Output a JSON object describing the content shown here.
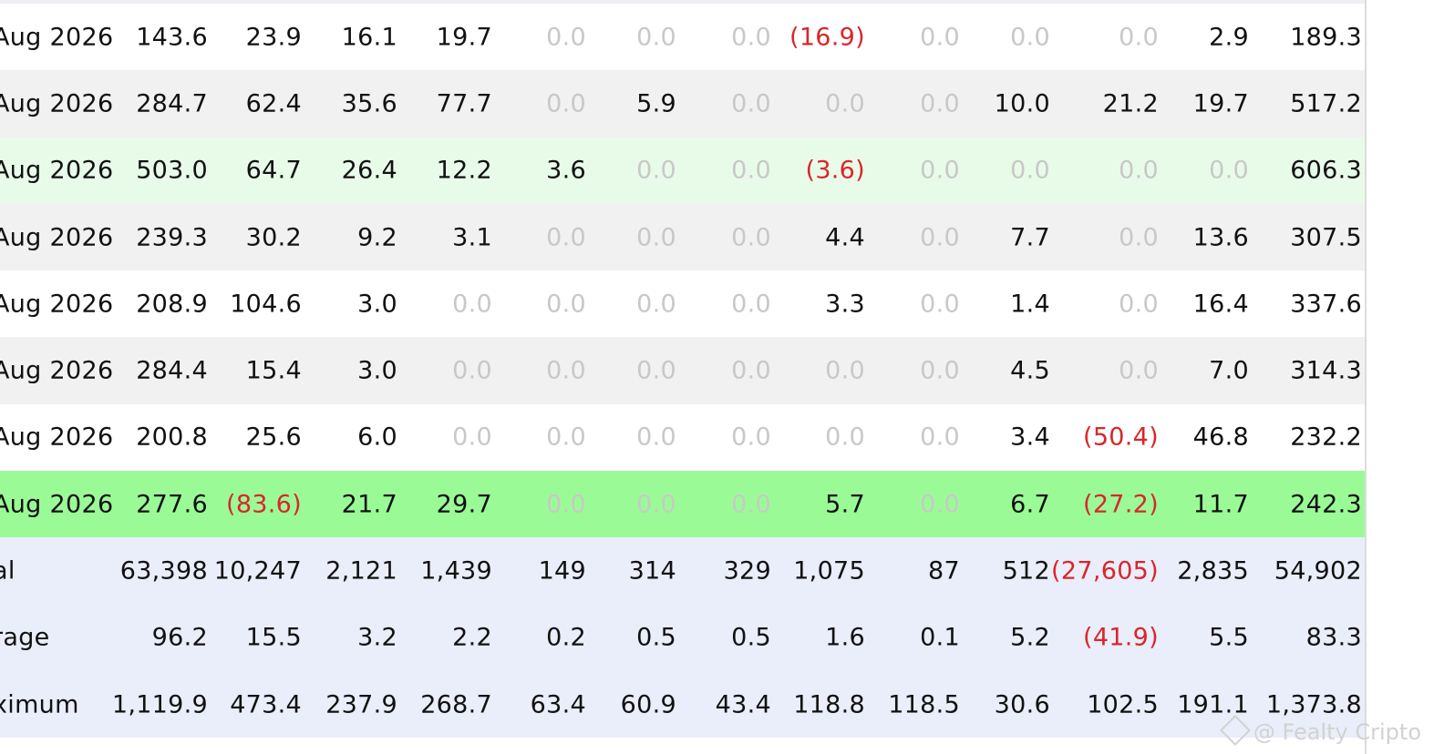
{
  "colors": {
    "row_white": "#ffffff",
    "row_gray": "#f1f1f1",
    "row_lightgreen": "#e8fbe9",
    "row_green": "#9afb96",
    "row_summary": "#eaedfa",
    "text": "#111111",
    "zero_text": "#c8c8c8",
    "negative_text": "#d9262b"
  },
  "rows": [
    {
      "label": "Aug 2026",
      "bg": "#ffffff",
      "values": [
        "143.6",
        "23.9",
        "16.1",
        "19.7",
        "0.0",
        "0.0",
        "0.0",
        "(16.9)",
        "0.0",
        "0.0",
        "0.0",
        "2.9",
        "189.3"
      ]
    },
    {
      "label": "Aug 2026",
      "bg": "#f1f1f1",
      "values": [
        "284.7",
        "62.4",
        "35.6",
        "77.7",
        "0.0",
        "5.9",
        "0.0",
        "0.0",
        "0.0",
        "10.0",
        "21.2",
        "19.7",
        "517.2"
      ]
    },
    {
      "label": "Aug 2026",
      "bg": "#e8fbe9",
      "values": [
        "503.0",
        "64.7",
        "26.4",
        "12.2",
        "3.6",
        "0.0",
        "0.0",
        "(3.6)",
        "0.0",
        "0.0",
        "0.0",
        "0.0",
        "606.3"
      ]
    },
    {
      "label": "Aug 2026",
      "bg": "#f1f1f1",
      "values": [
        "239.3",
        "30.2",
        "9.2",
        "3.1",
        "0.0",
        "0.0",
        "0.0",
        "4.4",
        "0.0",
        "7.7",
        "0.0",
        "13.6",
        "307.5"
      ]
    },
    {
      "label": "Aug 2026",
      "bg": "#ffffff",
      "values": [
        "208.9",
        "104.6",
        "3.0",
        "0.0",
        "0.0",
        "0.0",
        "0.0",
        "3.3",
        "0.0",
        "1.4",
        "0.0",
        "16.4",
        "337.6"
      ]
    },
    {
      "label": "Aug 2026",
      "bg": "#f1f1f1",
      "values": [
        "284.4",
        "15.4",
        "3.0",
        "0.0",
        "0.0",
        "0.0",
        "0.0",
        "0.0",
        "0.0",
        "4.5",
        "0.0",
        "7.0",
        "314.3"
      ]
    },
    {
      "label": "Aug 2026",
      "bg": "#ffffff",
      "values": [
        "200.8",
        "25.6",
        "6.0",
        "0.0",
        "0.0",
        "0.0",
        "0.0",
        "0.0",
        "0.0",
        "3.4",
        "(50.4)",
        "46.8",
        "232.2"
      ]
    },
    {
      "label": "Aug 2026",
      "bg": "#9afb96",
      "values": [
        "277.6",
        "(83.6)",
        "21.7",
        "29.7",
        "0.0",
        "0.0",
        "0.0",
        "5.7",
        "0.0",
        "6.7",
        "(27.2)",
        "11.7",
        "242.3"
      ]
    },
    {
      "label": "al",
      "bg": "#eaedfa",
      "summary": true,
      "values": [
        "63,398",
        "10,247",
        "2,121",
        "1,439",
        "149",
        "314",
        "329",
        "1,075",
        "87",
        "512",
        "(27,605)",
        "2,835",
        "54,902"
      ]
    },
    {
      "label": "rage",
      "bg": "#eaedfa",
      "summary": true,
      "values": [
        "96.2",
        "15.5",
        "3.2",
        "2.2",
        "0.2",
        "0.5",
        "0.5",
        "1.6",
        "0.1",
        "5.2",
        "(41.9)",
        "5.5",
        "83.3"
      ]
    },
    {
      "label": "ximum",
      "bg": "#eaedfa",
      "summary": true,
      "values": [
        "1,119.9",
        "473.4",
        "237.9",
        "268.7",
        "63.4",
        "60.9",
        "43.4",
        "118.8",
        "118.5",
        "30.6",
        "102.5",
        "191.1",
        "1,373.8"
      ]
    }
  ],
  "watermark": {
    "icon": "binance-square-icon",
    "text": "@ Fealty Cripto"
  }
}
